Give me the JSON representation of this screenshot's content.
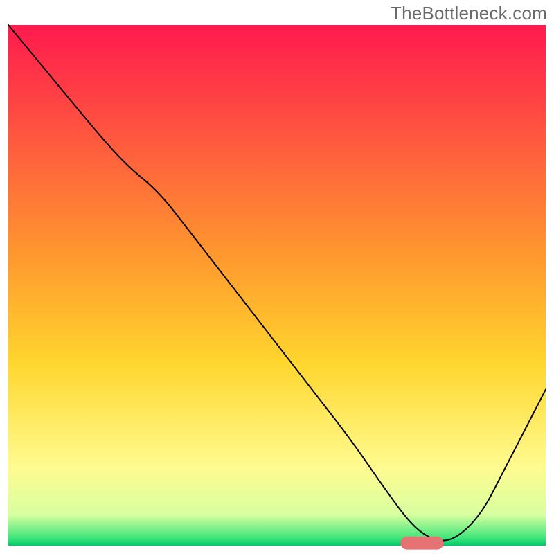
{
  "watermark": "TheBottleneck.com",
  "chart_data": {
    "type": "line",
    "title": "",
    "xlabel": "",
    "ylabel": "",
    "axis_visible": false,
    "grid": false,
    "xlim": [
      0,
      100
    ],
    "ylim": [
      0,
      100
    ],
    "background_gradient": {
      "stops": [
        {
          "offset": 0,
          "color": "#ff1a4e"
        },
        {
          "offset": 0.45,
          "color": "#ff9a2e"
        },
        {
          "offset": 0.65,
          "color": "#ffd62e"
        },
        {
          "offset": 0.85,
          "color": "#fffb90"
        },
        {
          "offset": 0.94,
          "color": "#d8ffa0"
        },
        {
          "offset": 0.985,
          "color": "#41e67a"
        },
        {
          "offset": 1.0,
          "color": "#00c86a"
        }
      ]
    },
    "series": [
      {
        "name": "bottleneck-curve",
        "color": "#000000",
        "width": 2,
        "x": [
          0,
          8,
          16,
          22,
          28,
          34,
          40,
          46,
          52,
          58,
          64,
          70,
          75,
          79,
          83,
          88,
          92,
          96,
          100
        ],
        "y": [
          100,
          90,
          80,
          73,
          68,
          60,
          52,
          44,
          36,
          28,
          20,
          11,
          4,
          1,
          1,
          6,
          14,
          22,
          30
        ]
      }
    ],
    "marker": {
      "name": "optimal-range-marker",
      "color": "#e57373",
      "x_center": 77,
      "y": 0.5,
      "width": 8,
      "height": 2.5,
      "rx": 1.25
    }
  }
}
